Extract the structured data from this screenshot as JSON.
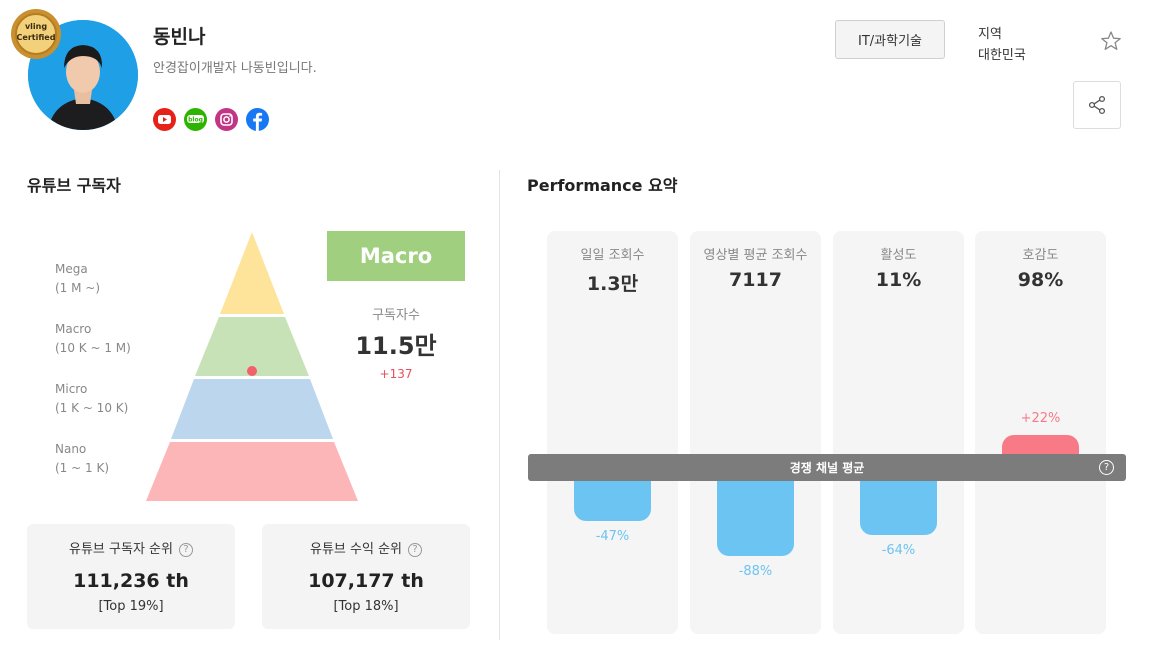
{
  "profile": {
    "name": "동빈나",
    "bio": "안경잡이개발자 나동빈입니다.",
    "badge_line1": "vling",
    "badge_line2": "Certified",
    "socials": [
      {
        "icon": "youtube-icon",
        "color": "#e62117"
      },
      {
        "icon": "blog-icon",
        "color": "#2db400"
      },
      {
        "icon": "instagram-icon",
        "color": "#c13584"
      },
      {
        "icon": "facebook-icon",
        "color": "#1877f2"
      }
    ]
  },
  "header": {
    "category": "IT/과학기술",
    "region_label": "지역",
    "region_value": "대한민국"
  },
  "subscribers": {
    "section_title": "유튜브 구독자",
    "tiers": [
      {
        "name": "Mega",
        "range": "(1 M ~)",
        "color": "#fde49a"
      },
      {
        "name": "Macro",
        "range": "(10 K ~ 1 M)",
        "color": "#c8e2b7"
      },
      {
        "name": "Micro",
        "range": "(1 K ~ 10 K)",
        "color": "#bcd6ee"
      },
      {
        "name": "Nano",
        "range": "(1 ~ 1 K)",
        "color": "#fdb6b8"
      }
    ],
    "tier_badge": "Macro",
    "count_label": "구독자수",
    "count_value": "11.5만",
    "count_delta": "+137",
    "rank_cards": [
      {
        "title": "유튜브 구독자 순위",
        "value": "111,236 th",
        "top": "[Top 19%]"
      },
      {
        "title": "유튜브 수익 순위",
        "value": "107,177 th",
        "top": "[Top 18%]"
      }
    ]
  },
  "performance": {
    "section_title": "Performance 요약",
    "metrics": [
      {
        "label": "일일 조회수",
        "value": "1.3만",
        "diff": "-47%",
        "diff_value": -47
      },
      {
        "label": "영상별 평균 조회수",
        "value": "7117",
        "diff": "-88%",
        "diff_value": -88
      },
      {
        "label": "활성도",
        "value": "11%",
        "diff": "-64%",
        "diff_value": -64
      },
      {
        "label": "호감도",
        "value": "98%",
        "diff": "+22%",
        "diff_value": 22
      }
    ],
    "average_label": "경쟁 채널 평균",
    "colors": {
      "negative": "#6cc4f2",
      "positive": "#f87a87"
    }
  }
}
